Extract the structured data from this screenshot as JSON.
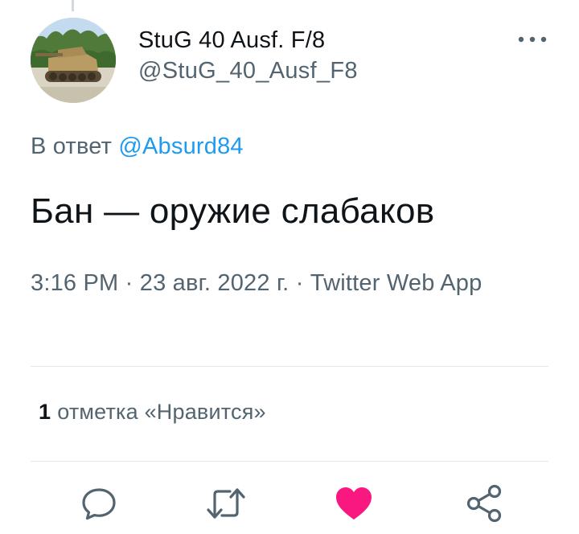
{
  "user": {
    "display_name": "StuG 40 Ausf. F/8",
    "handle": "@StuG_40_Ausf_F8",
    "avatar_icon": "tank-photo-avatar"
  },
  "more_icon": "ellipsis-icon",
  "reply": {
    "prefix": "В ответ",
    "mention": "@Absurd84"
  },
  "tweet": {
    "text": "Бан — оружие слабаков",
    "meta": "3:16 PM · 23 авг. 2022 г. · Twitter Web App"
  },
  "stats": {
    "likes_count": "1",
    "likes_label": "отметка «Нравится»"
  },
  "actions": [
    {
      "name": "reply",
      "icon": "comment-icon"
    },
    {
      "name": "retweet",
      "icon": "retweet-icon"
    },
    {
      "name": "like",
      "icon": "heart-icon",
      "active": true
    },
    {
      "name": "share",
      "icon": "share-icon"
    }
  ],
  "colors": {
    "accent": "#1d9bf0",
    "like": "#f91880",
    "secondary_text": "#536471"
  }
}
